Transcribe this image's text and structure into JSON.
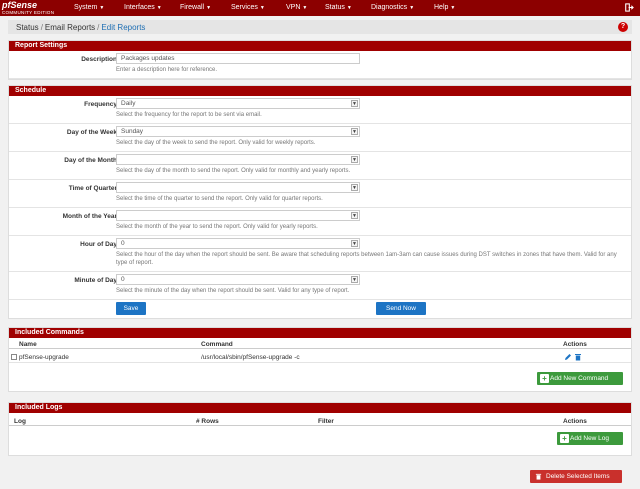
{
  "nav": {
    "brand": "pfSense",
    "brand_sub": "COMMUNITY EDITION",
    "menus": [
      "System",
      "Interfaces",
      "Firewall",
      "Services",
      "VPN",
      "Status",
      "Diagnostics",
      "Help"
    ],
    "caret": "▼",
    "logout_icon": "logout-icon"
  },
  "breadcrumb": {
    "items": [
      "Status",
      "Email Reports",
      "Edit Reports"
    ],
    "separator": "/",
    "help_glyph": "?"
  },
  "report_settings": {
    "title": "Report Settings",
    "description": {
      "label": "Description",
      "value": "Packages updates",
      "help": "Enter a description here for reference."
    }
  },
  "schedule": {
    "title": "Schedule",
    "fields": [
      {
        "label": "Frequency",
        "value": "Daily",
        "help": "Select the frequency for the report to be sent via email."
      },
      {
        "label": "Day of the Week",
        "value": "Sunday",
        "help": "Select the day of the week to send the report. Only valid for weekly reports."
      },
      {
        "label": "Day of the Month",
        "value": "",
        "help": "Select the day of the month to send the report. Only valid for monthly and yearly reports."
      },
      {
        "label": "Time of Quarter",
        "value": "",
        "help": "Select the time of the quarter to send the report. Only valid for quarter reports."
      },
      {
        "label": "Month of the Year",
        "value": "",
        "help": "Select the month of the year to send the report. Only valid for yearly reports."
      },
      {
        "label": "Hour of Day",
        "value": "0",
        "help": "Select the hour of the day when the report should be sent. Be aware that scheduling reports between 1am-3am can cause issues during DST switches in zones that have them. Valid for any type of report."
      },
      {
        "label": "Minute of Day",
        "value": "0",
        "help": "Select the minute of the day when the report should be sent. Valid for any type of report."
      }
    ],
    "save_label": "Save",
    "send_now_label": "Send Now"
  },
  "commands": {
    "title": "Included Commands",
    "columns": [
      "Name",
      "Command",
      "Actions"
    ],
    "rows": [
      {
        "name": "pfSense-upgrade",
        "command": "/usr/local/sbin/pfSense-upgrade -c"
      }
    ],
    "add_label": "Add New Command"
  },
  "logs": {
    "title": "Included Logs",
    "columns": [
      "Log",
      "# Rows",
      "Filter",
      "Actions"
    ],
    "add_label": "Add New Log"
  },
  "delete_label": "Delete Selected Items",
  "colors": {
    "brand_red": "#8c0000",
    "panel_red": "#a00000",
    "link_blue": "#1f6fb3",
    "button_blue": "#1d74c4",
    "button_green": "#3c9a3c",
    "button_red": "#c9302c"
  }
}
